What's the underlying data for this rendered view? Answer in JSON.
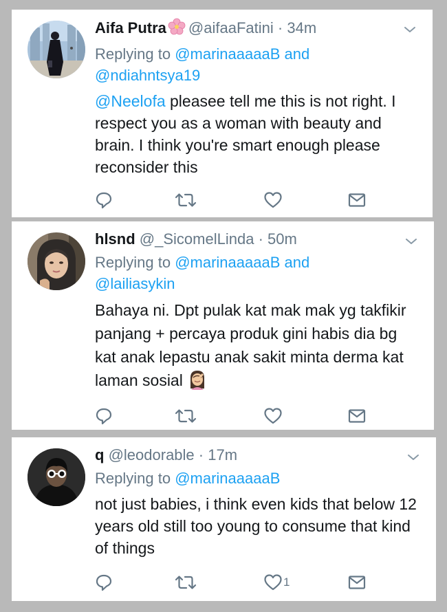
{
  "colors": {
    "link": "#1da1f2",
    "muted": "#657786",
    "text": "#14171a",
    "background": "#b9b9b9"
  },
  "tweets": [
    {
      "name": "Aifa Putra",
      "name_emoji": "cherry-blossom-icon",
      "handle": "@aifaaFatini",
      "separator": "·",
      "time": "34m",
      "replying_prefix": "Replying to",
      "replying_first": "@marinaaaaaB",
      "replying_joiner": "and",
      "replying_second": "@ndiahntsya19",
      "body_mention": "@Neelofa",
      "body": "pleasee tell me this is not right. I respect you as a woman with beauty and brain. I think you're smart enough please reconsider this",
      "likes": ""
    },
    {
      "name": "hlsnd",
      "handle": "@_SicomelLinda",
      "separator": "·",
      "time": "50m",
      "replying_prefix": "Replying to",
      "replying_first": "@marinaaaaaB",
      "replying_joiner": "and",
      "replying_second": "@lailiasykin",
      "body": "Bahaya ni. Dpt pulak kat mak mak yg takfikir panjang + percaya produk gini habis dia bg kat anak lepastu anak sakit minta derma kat laman sosial",
      "body_emoji": "woman-facepalming-icon",
      "likes": ""
    },
    {
      "name": "q",
      "handle": "@leodorable",
      "separator": "·",
      "time": "17m",
      "replying_prefix": "Replying to",
      "replying_first": "@marinaaaaaB",
      "body": "not just babies, i think even kids that below 12 years old still too young to consume that kind of things",
      "likes": "1"
    }
  ]
}
